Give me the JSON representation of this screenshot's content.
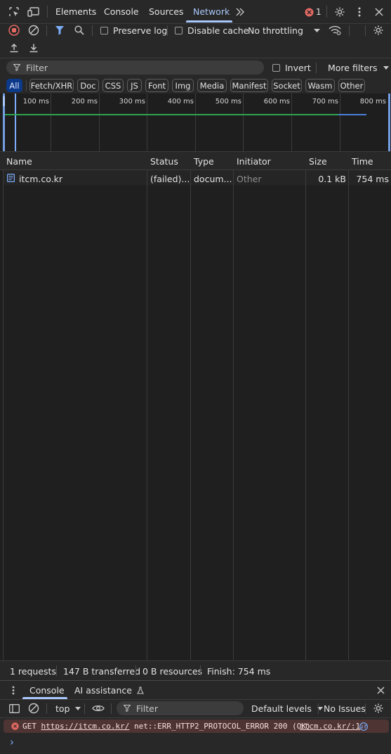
{
  "toolbar": {
    "tabs": [
      {
        "label": "Elements"
      },
      {
        "label": "Console"
      },
      {
        "label": "Sources"
      },
      {
        "label": "Network"
      }
    ],
    "error_count": "1"
  },
  "network_toolbar": {
    "preserve_log": "Preserve log",
    "disable_cache": "Disable cache",
    "throttling": "No throttling"
  },
  "filter_bar": {
    "placeholder": "Filter",
    "invert": "Invert",
    "more_filters": "More filters"
  },
  "type_filters": [
    "All",
    "Fetch/XHR",
    "Doc",
    "CSS",
    "JS",
    "Font",
    "Img",
    "Media",
    "Manifest",
    "Socket",
    "Wasm",
    "Other"
  ],
  "timeline": {
    "ticks": [
      "100 ms",
      "200 ms",
      "300 ms",
      "400 ms",
      "500 ms",
      "600 ms",
      "700 ms",
      "800 ms"
    ],
    "colors": {
      "waiting": "#2ea44f",
      "download": "#4a80d8",
      "marker": "#7cacf8"
    }
  },
  "table": {
    "headers": [
      "Name",
      "Status",
      "Type",
      "Initiator",
      "Size",
      "Time"
    ],
    "rows": [
      {
        "name": "itcm.co.kr",
        "status": "(failed)...",
        "type": "docum...",
        "initiator": "Other",
        "size": "0.1 kB",
        "time": "754 ms"
      }
    ]
  },
  "summary": {
    "requests": "1 requests",
    "transferred": "147 B transferred",
    "resources": "0 B resources",
    "finish": "Finish: 754 ms"
  },
  "drawer": {
    "tabs": [
      {
        "label": "Console"
      },
      {
        "label": "AI assistance"
      }
    ],
    "context": "top",
    "filter_placeholder": "Filter",
    "levels": "Default levels",
    "issues": "No Issues",
    "error_message": {
      "method": "GET",
      "url": "https://itcm.co.kr/",
      "text": "net::ERR_HTTP2_PROTOCOL_ERROR 200 (OK)",
      "source": "itcm.co.kr/:1"
    },
    "prompt": "›"
  }
}
